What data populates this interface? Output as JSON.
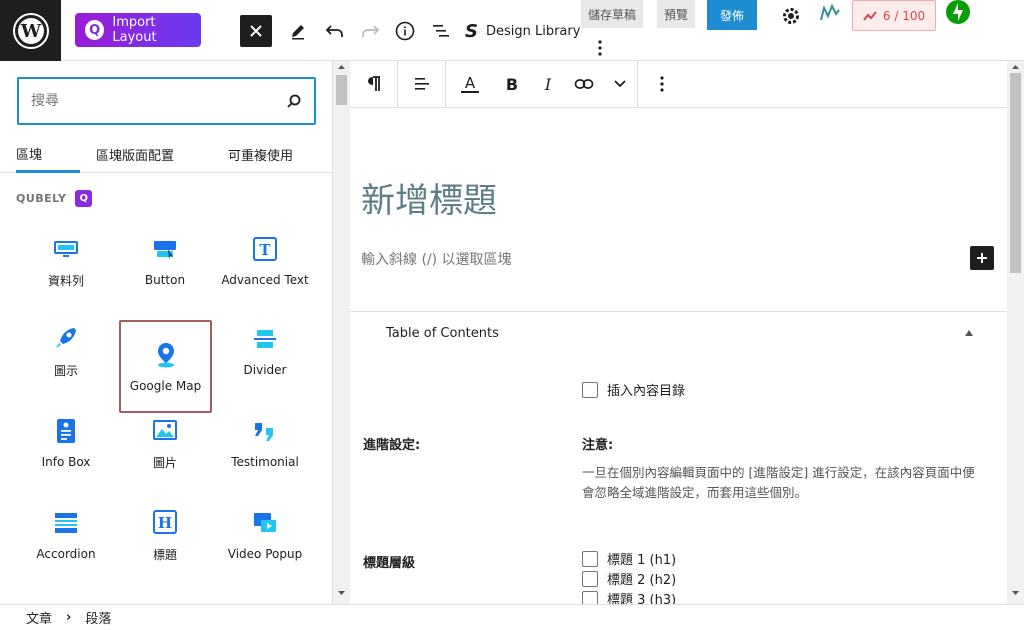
{
  "topbar": {
    "import_layout_label": "Import Layout",
    "design_library_label": "Design Library",
    "save_draft_label": "儲存草稿",
    "preview_label": "預覽",
    "publish_label": "發佈",
    "score_label": "6 / 100"
  },
  "sidebar": {
    "search_placeholder": "搜尋",
    "tabs": [
      {
        "label": "區塊"
      },
      {
        "label": "區塊版面配置"
      },
      {
        "label": "可重複使用"
      }
    ],
    "category_label": "QUBELY",
    "blocks": [
      {
        "label": "資料列",
        "icon": "row-icon"
      },
      {
        "label": "Button",
        "icon": "button-icon"
      },
      {
        "label": "Advanced Text",
        "icon": "advanced-text-icon"
      },
      {
        "label": "圖示",
        "icon": "rocket-icon"
      },
      {
        "label": "Google Map",
        "icon": "map-pin-icon"
      },
      {
        "label": "Divider",
        "icon": "divider-icon"
      },
      {
        "label": "Info Box",
        "icon": "info-box-icon"
      },
      {
        "label": "圖片",
        "icon": "image-icon"
      },
      {
        "label": "Testimonial",
        "icon": "testimonial-icon"
      },
      {
        "label": "Accordion",
        "icon": "accordion-icon"
      },
      {
        "label": "標題",
        "icon": "heading-icon"
      },
      {
        "label": "Video Popup",
        "icon": "video-popup-icon"
      }
    ]
  },
  "editor": {
    "post_title": "新增標題",
    "placeholder": "輸入斜線 (/) 以選取區塊",
    "toc": {
      "title": "Table of Contents",
      "insert_toc_label": "插入內容目錄",
      "advanced_label": "進階設定:",
      "note_title": "注意:",
      "note_text": "一旦在個別內容編輯頁面中的 [進階設定] 進行設定，在該內容頁面中便會忽略全域進階設定，而套用這些個別。",
      "heading_levels_label": "標題層級",
      "levels": [
        {
          "label": "標題 1 (h1)"
        },
        {
          "label": "標題 2 (h2)"
        },
        {
          "label": "標題 3 (h3)"
        }
      ]
    }
  },
  "footer": {
    "crumb_1": "文章",
    "crumb_2": "段落"
  },
  "colors": {
    "accent": "#1e8cd1",
    "qubely_purple": "#8a2be2",
    "icon_blue": "#1a73e8",
    "score_red": "#d94848",
    "jetpack_green": "#069e08"
  }
}
